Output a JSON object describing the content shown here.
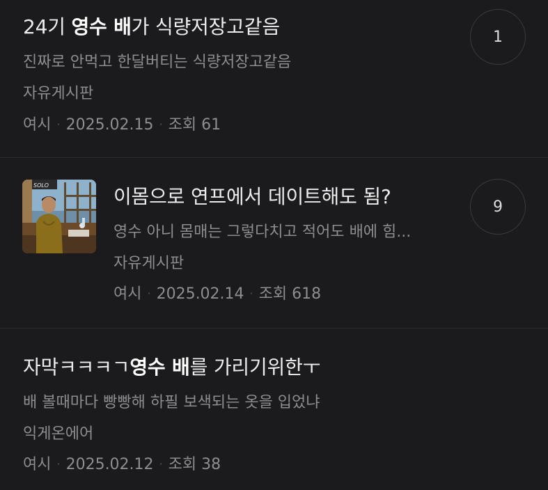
{
  "posts": [
    {
      "title_parts": [
        "24기 ",
        "영수 배",
        "가 식량저장고같음"
      ],
      "excerpt": "진짜로 안먹고 한달버티는 식량저장고같음",
      "board": "자유게시판",
      "author": "여시",
      "date": "2025.02.15",
      "views_label": "조회",
      "views": "61",
      "comments": "1"
    },
    {
      "title": "이몸으로 연프에서 데이트해도 됨?",
      "excerpt": "영수 아니 몸매는 그렇다치고 적어도 배에 힘...",
      "board": "자유게시판",
      "author": "여시",
      "date": "2025.02.14",
      "views_label": "조회",
      "views": "618",
      "comments": "9",
      "thumbnail_text": "SOLO"
    },
    {
      "title_parts": [
        "자막ㅋㅋㅋㄱ",
        "영수 배",
        "를 가리기위한ㅜ"
      ],
      "excerpt": "배 볼때마다 빵빵해 하필 보색되는 옷을 입었냐",
      "board": "익게온에어",
      "author": "여시",
      "date": "2025.02.12",
      "views_label": "조회",
      "views": "38"
    }
  ],
  "colors": {
    "background": "#1b1b1d",
    "title": "#ededee",
    "secondary": "#8d8d92",
    "divider": "#2c2c2f"
  }
}
